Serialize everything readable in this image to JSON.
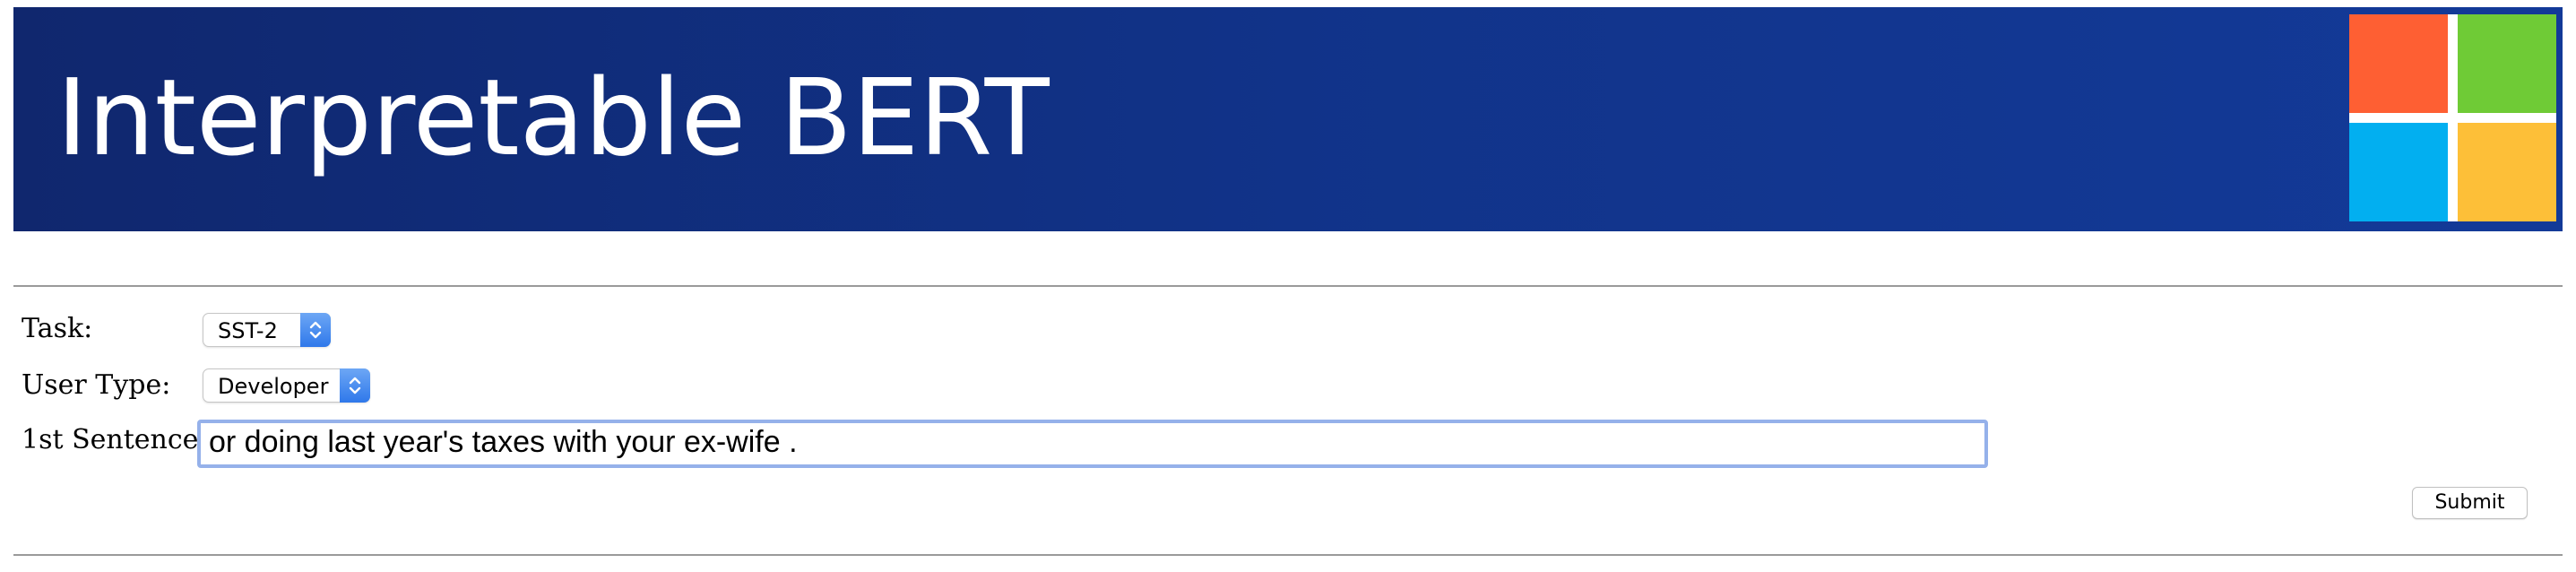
{
  "header": {
    "title": "Interpretable BERT",
    "logo": {
      "icon": "microsoft-logo-icon",
      "colors": [
        "#fe5f33",
        "#6fcb36",
        "#02aff0",
        "#fdbf38"
      ],
      "background": "#ffffff"
    },
    "background_colors": [
      "#10276e",
      "#133a98"
    ]
  },
  "form": {
    "task": {
      "label": "Task:",
      "selected": "SST-2"
    },
    "user_type": {
      "label": "User Type:",
      "selected": "Developer"
    },
    "sentence": {
      "label": "1st Sentence:",
      "value": "or doing last year's taxes with your ex-wife ."
    },
    "submit_label": "Submit"
  },
  "colors": {
    "select_arrow": "#2f78ea",
    "input_focus_border": "#95b1ea",
    "rule": "#9a9a9a"
  }
}
